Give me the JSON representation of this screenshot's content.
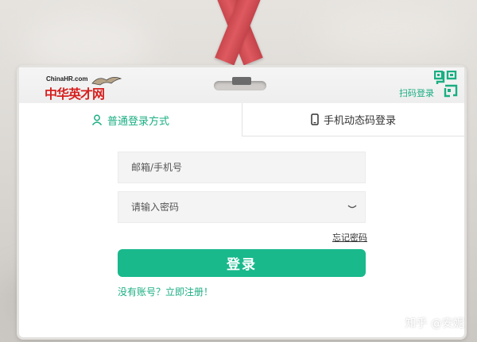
{
  "brand": {
    "logo_sub": "ChinaHR.com",
    "logo_main": "中华英才网",
    "logo_color": "#d5201f"
  },
  "header": {
    "qr_login_label": "扫码登录",
    "qr_icon": "qr-code-icon"
  },
  "tabs": [
    {
      "label": "普通登录方式",
      "icon": "user-icon",
      "active": true
    },
    {
      "label": "手机动态码登录",
      "icon": "mobile-phone-icon",
      "active": false
    }
  ],
  "form": {
    "account_placeholder": "邮箱/手机号",
    "account_value": "",
    "password_placeholder": "请输入密码",
    "password_value": "",
    "password_toggle_icon": "eye-closed-icon",
    "forgot_label": "忘记密码",
    "submit_label": "登录",
    "register_label": "没有账号？立即注册！"
  },
  "watermark": "知乎 @安妮",
  "colors": {
    "accent": "#19b98c",
    "accent_text": "#1aae82",
    "strap": "#d4484e"
  }
}
